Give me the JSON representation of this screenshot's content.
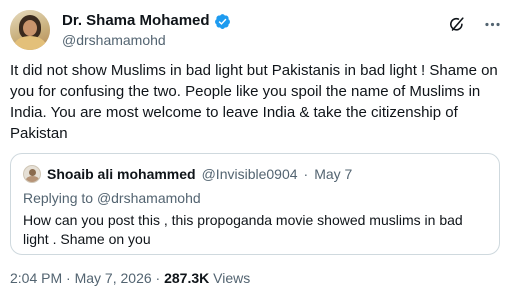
{
  "author": {
    "display_name": "Dr. Shama Mohamed",
    "handle": "@drshamamohd",
    "verified": true
  },
  "icons": [
    "grok-icon",
    "more-icon"
  ],
  "tweet": {
    "text": "It did not show Muslims in bad light but Pakistanis in bad light ! Shame on you for confusing the two. People like you spoil the name of Muslims in India. You are most welcome to leave India & take the citizenship of Pakistan"
  },
  "quoted": {
    "display_name": "Shoaib ali mohammed",
    "handle": "@Invisible0904",
    "separator": "·",
    "date": "May 7",
    "replying_prefix": "Replying to",
    "replying_handle": "@drshamamohd",
    "text": "How can you post this , this propoganda movie showed muslims in bad light . Shame on you"
  },
  "meta": {
    "time": "2:04 PM",
    "separator": "·",
    "date": "May 7, 2026",
    "views_count": "287.3K",
    "views_label": "Views"
  },
  "colors": {
    "text": "#0f1419",
    "secondary": "#536471",
    "verified": "#1d9bf0",
    "border": "#cfd9de"
  }
}
